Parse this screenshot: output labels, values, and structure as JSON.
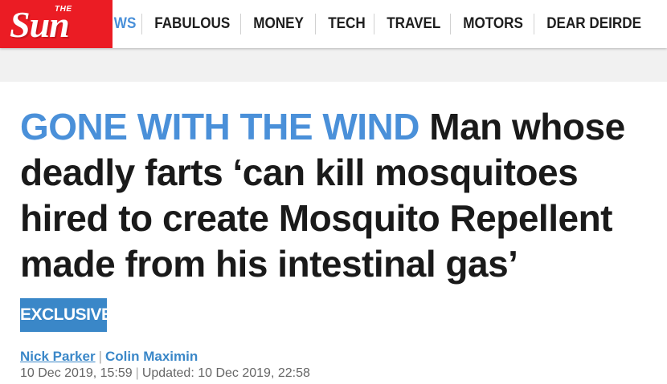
{
  "brand": {
    "the": "THE",
    "name": "Sun",
    "color": "#eb1c24"
  },
  "nav": {
    "items": [
      "WS",
      "FABULOUS",
      "MONEY",
      "TECH",
      "TRAVEL",
      "MOTORS",
      "DEAR DEIRDE"
    ]
  },
  "article": {
    "kicker": "GONE WITH THE WIND",
    "headline": "Man whose deadly farts ‘can kill mosquitoes hired to create Mosquito Repellent made from his intestinal gas’",
    "badge": "EXCLUSIVE",
    "authors": [
      "Nick Parker",
      "Colin Maximin"
    ],
    "published": "10 Dec 2019, 15:59",
    "updated": "Updated: 10 Dec 2019, 22:58"
  },
  "colors": {
    "accent_blue": "#4a90d9",
    "badge_blue": "#3a87c8"
  }
}
